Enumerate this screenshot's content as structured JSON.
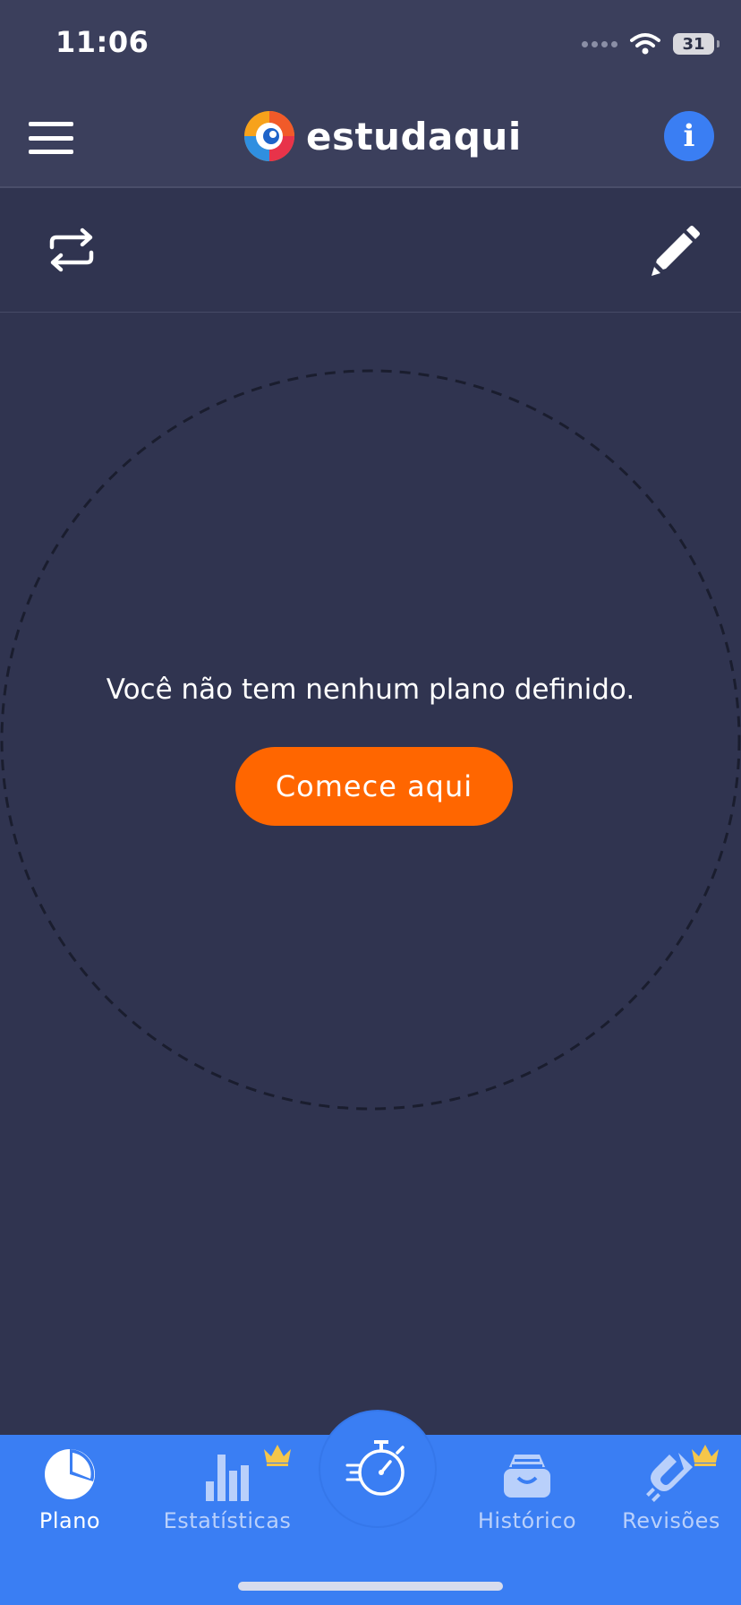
{
  "status_bar": {
    "time": "11:06",
    "battery": "31"
  },
  "header": {
    "brand_name": "estudaqui",
    "info_label": "i"
  },
  "main": {
    "empty_message": "Você não tem nenhum plano definido.",
    "start_button_label": "Comece aqui"
  },
  "bottom_nav": {
    "items": [
      {
        "label": "Plano",
        "icon": "pie-chart-icon",
        "active": true
      },
      {
        "label": "Estatísticas",
        "icon": "bar-chart-icon",
        "premium": true
      },
      {
        "label": "Histórico",
        "icon": "archive-box-icon"
      },
      {
        "label": "Revisões",
        "icon": "magnet-icon",
        "premium": true
      }
    ],
    "center_action_icon": "stopwatch-icon"
  },
  "colors": {
    "background": "#303450",
    "header": "#3b3f5c",
    "accent_blue": "#3a7ef3",
    "cta_orange": "#ff6600"
  }
}
